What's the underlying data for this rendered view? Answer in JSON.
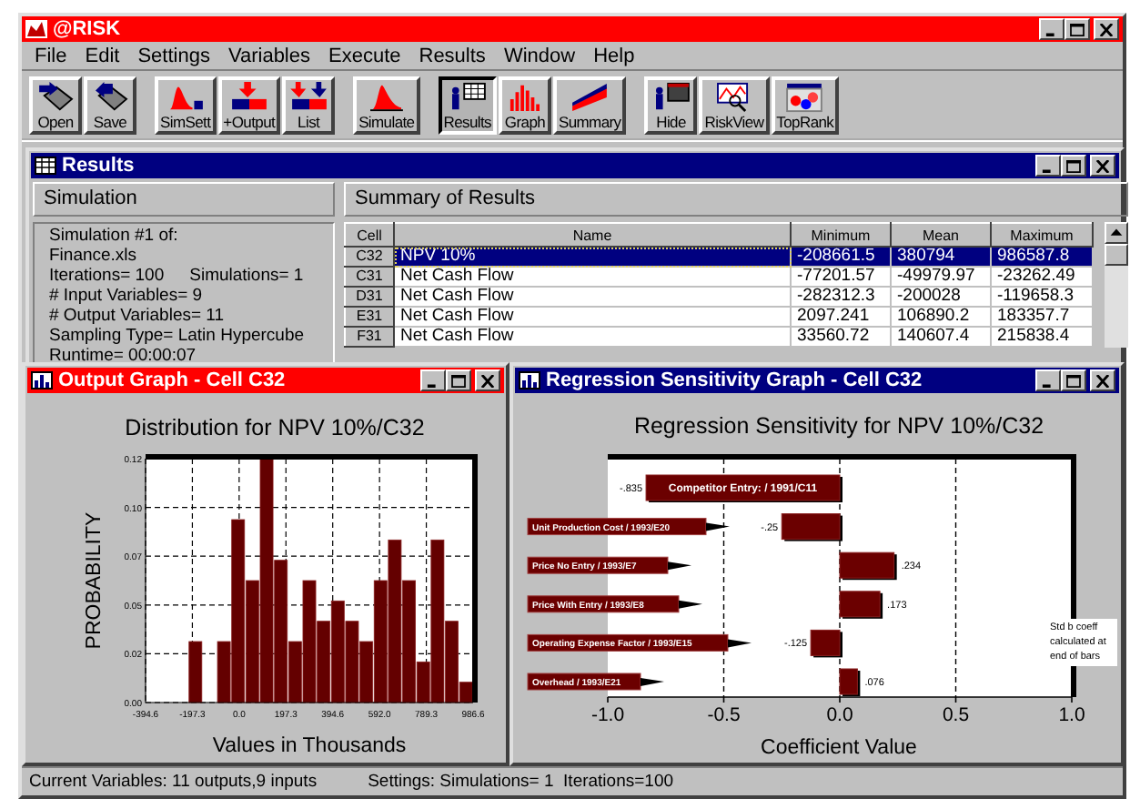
{
  "app": {
    "title": "@RISK",
    "active": true
  },
  "menu": [
    "File",
    "Edit",
    "Settings",
    "Variables",
    "Execute",
    "Results",
    "Window",
    "Help"
  ],
  "toolbar": {
    "groups": [
      {
        "buttons": [
          {
            "label": "Open",
            "pressed": false
          },
          {
            "label": "Save",
            "pressed": false
          }
        ]
      },
      {
        "buttons": [
          {
            "label": "SimSett",
            "pressed": false
          },
          {
            "label": "+Output",
            "pressed": false
          },
          {
            "label": "List",
            "pressed": false
          }
        ]
      },
      {
        "buttons": [
          {
            "label": "Simulate",
            "pressed": false
          }
        ]
      },
      {
        "buttons": [
          {
            "label": "Results",
            "pressed": true
          },
          {
            "label": "Graph",
            "pressed": false
          },
          {
            "label": "Summary",
            "pressed": false
          }
        ]
      },
      {
        "buttons": [
          {
            "label": "Hide",
            "pressed": false
          },
          {
            "label": "RiskView",
            "pressed": false
          },
          {
            "label": "TopRank",
            "pressed": false
          }
        ]
      }
    ]
  },
  "results_window": {
    "title": "Results",
    "active": false,
    "simulation": {
      "heading": "Simulation",
      "lines": [
        [
          "Simulation #1 of:"
        ],
        [
          "Finance.xls"
        ],
        [
          "Iterations= 100",
          "Simulations= 1"
        ],
        [
          "# Input Variables= 9"
        ],
        [
          "# Output Variables= 11"
        ],
        [
          "Sampling Type= Latin Hypercube"
        ],
        [
          "Runtime= 00:00:07"
        ]
      ]
    },
    "summary": {
      "heading": "Summary of Results",
      "columns": [
        "Cell",
        "Name",
        "Minimum",
        "Mean",
        "Maximum"
      ],
      "rows": [
        {
          "cell": "C32",
          "name": "NPV 10%",
          "minimum": "-208661.5",
          "mean": "380794",
          "maximum": "986587.8",
          "selected": true
        },
        {
          "cell": "C31",
          "name": "Net Cash Flow",
          "minimum": "-77201.57",
          "mean": "-49979.97",
          "maximum": "-23262.49",
          "selected": false
        },
        {
          "cell": "D31",
          "name": "Net Cash Flow",
          "minimum": "-282312.3",
          "mean": "-200028",
          "maximum": "-119658.3",
          "selected": false
        },
        {
          "cell": "E31",
          "name": "Net Cash Flow",
          "minimum": "2097.241",
          "mean": "106890.2",
          "maximum": "183357.7",
          "selected": false
        },
        {
          "cell": "F31",
          "name": "Net Cash Flow",
          "minimum": "33560.72",
          "mean": "140607.4",
          "maximum": "215838.4",
          "selected": false
        }
      ]
    }
  },
  "output_graph": {
    "title": "Output Graph - Cell C32",
    "active": true,
    "chart_data": {
      "type": "bar",
      "title": "Distribution for NPV 10%/C32",
      "xlabel": "Values in Thousands",
      "ylabel": "PROBABILITY",
      "x": [
        -364.6,
        -304.5,
        -244.5,
        -184.4,
        -124.4,
        -64.3,
        -4.3,
        55.8,
        115.8,
        175.9,
        235.9,
        296.0,
        356.0,
        416.1,
        476.1,
        536.2,
        596.3,
        656.3,
        716.4,
        776.4,
        836.5,
        896.5,
        956.6
      ],
      "values": [
        0,
        0,
        0,
        0.03,
        0,
        0.03,
        0.09,
        0.06,
        0.12,
        0.07,
        0.03,
        0.06,
        0.04,
        0.05,
        0.04,
        0.03,
        0.06,
        0.08,
        0.06,
        0.02,
        0.08,
        0.04,
        0.01
      ],
      "xlim": [
        -394.6,
        986.6
      ],
      "ylim": [
        0,
        0.12
      ],
      "grid": true,
      "xticks": [
        {
          "value": -394.6,
          "label": "-394.6"
        },
        {
          "value": -197.3,
          "label": "-197.3"
        },
        {
          "value": 0,
          "label": "0.0"
        },
        {
          "value": 197.3,
          "label": "197.3"
        },
        {
          "value": 394.6,
          "label": "394.6"
        },
        {
          "value": 592,
          "label": "592.0"
        },
        {
          "value": 789.3,
          "label": "789.3"
        },
        {
          "value": 986.6,
          "label": "986.6"
        }
      ],
      "yticks": [
        {
          "value": 0,
          "label": "0.00"
        },
        {
          "value": 0.024,
          "label": "0.02"
        },
        {
          "value": 0.048,
          "label": "0.05"
        },
        {
          "value": 0.072,
          "label": "0.07"
        },
        {
          "value": 0.096,
          "label": "0.10"
        },
        {
          "value": 0.12,
          "label": "0.12"
        }
      ]
    }
  },
  "regression_graph": {
    "title": "Regression Sensitivity Graph - Cell C32",
    "active": false,
    "chart_data": {
      "type": "bar",
      "orientation": "horizontal",
      "title": "Regression Sensitivity for NPV 10%/C32",
      "xlabel": "Coefficient Value",
      "categories": [
        "Competitor Entry: / 1991/C11",
        "Unit Production Cost / 1993/E20",
        "Price No Entry / 1993/E7",
        "Price With Entry / 1993/E8",
        "Operating Expense Factor / 1993/E15",
        "Overhead / 1993/E21"
      ],
      "values": [
        -0.835,
        -0.25,
        0.234,
        0.173,
        -0.125,
        0.076
      ],
      "value_labels": [
        "-.835",
        "-.25",
        ".234",
        ".173",
        "-.125",
        ".076"
      ],
      "xlim": [
        -1,
        1
      ],
      "grid": true,
      "xticks": [
        {
          "value": -1,
          "label": "-1.0"
        },
        {
          "value": -0.5,
          "label": "-0.5"
        },
        {
          "value": 0,
          "label": "0.0"
        },
        {
          "value": 0.5,
          "label": "0.5"
        },
        {
          "value": 1,
          "label": "1.0"
        }
      ],
      "annotations": [
        {
          "text": "Std b coeff calculated at end of bars"
        }
      ]
    }
  },
  "status_bar": {
    "variables": "Current Variables: 11 outputs,9 inputs",
    "settings": "Settings: Simulations= 1  Iterations=100"
  }
}
